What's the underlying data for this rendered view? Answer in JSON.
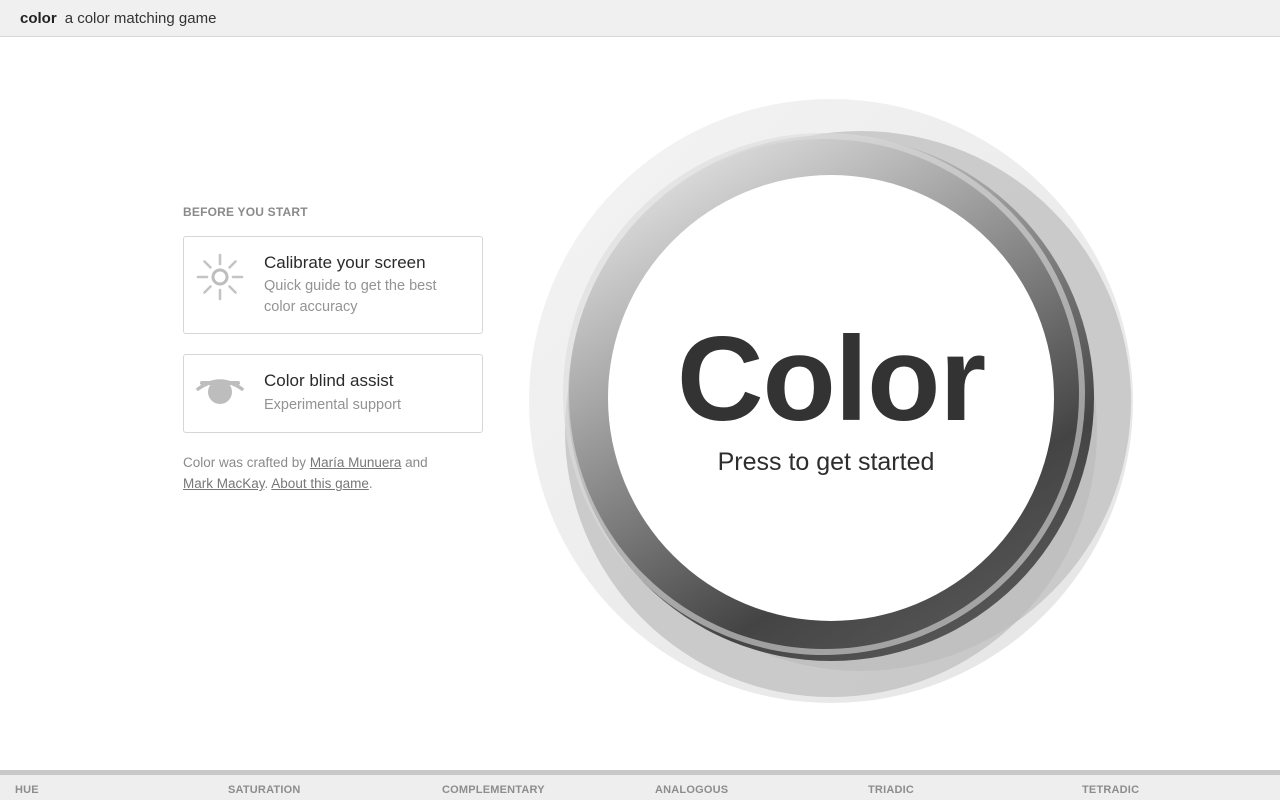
{
  "header": {
    "brand": "color",
    "tagline": "a color matching game"
  },
  "prelude": {
    "label": "BEFORE YOU START",
    "cards": [
      {
        "title": "Calibrate your screen",
        "subtitle": "Quick guide to get the best color accuracy",
        "icon": "sun-icon"
      },
      {
        "title": "Color blind assist",
        "subtitle": "Experimental support",
        "icon": "eye-icon"
      }
    ]
  },
  "credits": {
    "prefix": "Color was crafted by",
    "author1": "María Munuera",
    "and": "and",
    "author2": "Mark MacKay",
    "sep": ".",
    "about": "About this game",
    "end": "."
  },
  "start": {
    "title": "Color",
    "subtitle": "Press to get started"
  },
  "modes": [
    "HUE",
    "SATURATION",
    "COMPLEMENTARY",
    "ANALOGOUS",
    "TRIADIC",
    "TETRADIC"
  ],
  "colors": {
    "ring_dark": "#4a4a4a",
    "ring_light": "#bdbdbd",
    "halo": "#eeeeee"
  }
}
